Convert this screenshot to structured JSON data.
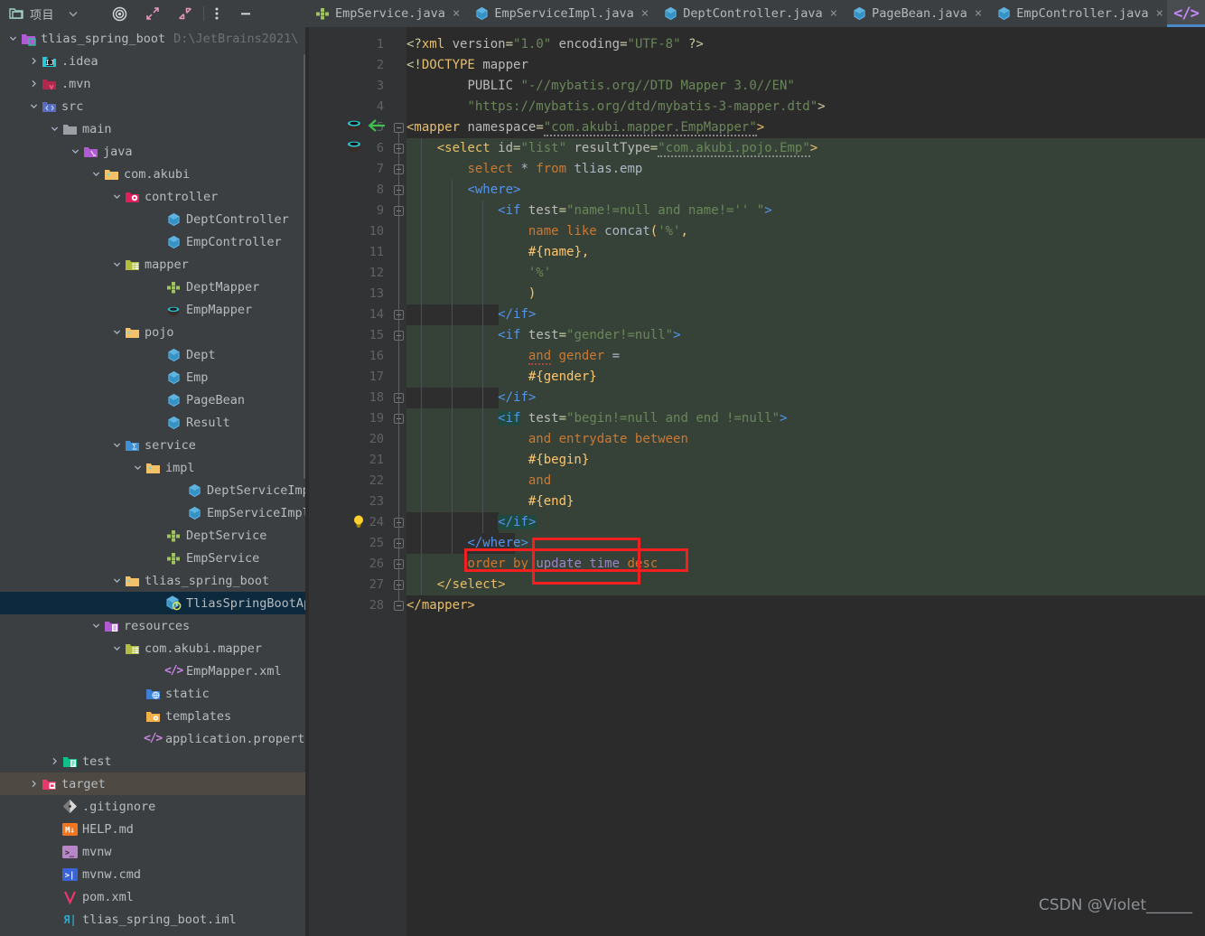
{
  "toolbar": {
    "project_label": "项目",
    "dropdown_icon": "chevron-down-icon",
    "locate_icon": "target-locate-icon",
    "expand_icon": "expand-all-icon",
    "collapse_icon": "collapse-all-icon",
    "options_icon": "more-options-icon",
    "minimize_icon": "minimize-icon"
  },
  "tabs": [
    {
      "label": "EmpService.java",
      "icon": "interface-icon",
      "close": "×"
    },
    {
      "label": "EmpServiceImpl.java",
      "icon": "class-icon",
      "close": "×"
    },
    {
      "label": "DeptController.java",
      "icon": "class-icon",
      "close": "×"
    },
    {
      "label": "PageBean.java",
      "icon": "class-icon",
      "close": "×"
    },
    {
      "label": "EmpController.java",
      "icon": "class-icon",
      "close": "×"
    }
  ],
  "code_toggle": {
    "glyph": "</>",
    "name": "code-view-toggle"
  },
  "sidebar": {
    "rows": [
      {
        "label": "tlias_spring_boot",
        "path": "D:\\JetBrains2021\\",
        "indent": 0,
        "arrow": "down",
        "icon": "module-folder-icon",
        "state": "normal"
      },
      {
        "label": ".idea",
        "path": "",
        "indent": 1,
        "arrow": "right",
        "icon": "idea-folder-icon",
        "state": "normal"
      },
      {
        "label": ".mvn",
        "path": "",
        "indent": 1,
        "arrow": "right",
        "icon": "maven-folder-icon",
        "state": "normal"
      },
      {
        "label": "src",
        "path": "",
        "indent": 1,
        "arrow": "down",
        "icon": "source-root-icon",
        "state": "normal"
      },
      {
        "label": "main",
        "path": "",
        "indent": 2,
        "arrow": "down",
        "icon": "plain-folder-icon",
        "state": "normal"
      },
      {
        "label": "java",
        "path": "",
        "indent": 3,
        "arrow": "down",
        "icon": "java-source-icon",
        "state": "normal"
      },
      {
        "label": "com.akubi",
        "path": "",
        "indent": 4,
        "arrow": "down",
        "icon": "package-icon",
        "state": "normal"
      },
      {
        "label": "controller",
        "path": "",
        "indent": 5,
        "arrow": "down",
        "icon": "spring-folder-icon",
        "state": "normal"
      },
      {
        "label": "DeptController",
        "path": "",
        "indent": 7,
        "arrow": "none",
        "icon": "class-icon",
        "state": "normal"
      },
      {
        "label": "EmpController",
        "path": "",
        "indent": 7,
        "arrow": "none",
        "icon": "class-icon",
        "state": "normal"
      },
      {
        "label": "mapper",
        "path": "",
        "indent": 5,
        "arrow": "down",
        "icon": "mapper-folder-icon",
        "state": "normal"
      },
      {
        "label": "DeptMapper",
        "path": "",
        "indent": 7,
        "arrow": "none",
        "icon": "interface-icon",
        "state": "normal"
      },
      {
        "label": "EmpMapper",
        "path": "",
        "indent": 7,
        "arrow": "none",
        "icon": "mybatis-icon",
        "state": "normal"
      },
      {
        "label": "pojo",
        "path": "",
        "indent": 5,
        "arrow": "down",
        "icon": "package-icon",
        "state": "normal"
      },
      {
        "label": "Dept",
        "path": "",
        "indent": 7,
        "arrow": "none",
        "icon": "class-icon",
        "state": "normal"
      },
      {
        "label": "Emp",
        "path": "",
        "indent": 7,
        "arrow": "none",
        "icon": "class-icon",
        "state": "normal"
      },
      {
        "label": "PageBean",
        "path": "",
        "indent": 7,
        "arrow": "none",
        "icon": "class-icon",
        "state": "normal"
      },
      {
        "label": "Result",
        "path": "",
        "indent": 7,
        "arrow": "none",
        "icon": "class-icon",
        "state": "normal"
      },
      {
        "label": "service",
        "path": "",
        "indent": 5,
        "arrow": "down",
        "icon": "service-folder-icon",
        "state": "normal"
      },
      {
        "label": "impl",
        "path": "",
        "indent": 6,
        "arrow": "down",
        "icon": "package-icon",
        "state": "normal"
      },
      {
        "label": "DeptServiceImpl",
        "path": "",
        "indent": 8,
        "arrow": "none",
        "icon": "class-icon",
        "state": "normal"
      },
      {
        "label": "EmpServiceImpl",
        "path": "",
        "indent": 8,
        "arrow": "none",
        "icon": "class-icon",
        "state": "normal"
      },
      {
        "label": "DeptService",
        "path": "",
        "indent": 7,
        "arrow": "none",
        "icon": "interface-icon",
        "state": "normal"
      },
      {
        "label": "EmpService",
        "path": "",
        "indent": 7,
        "arrow": "none",
        "icon": "interface-icon",
        "state": "normal"
      },
      {
        "label": "tlias_spring_boot",
        "path": "",
        "indent": 5,
        "arrow": "down",
        "icon": "package-icon",
        "state": "normal"
      },
      {
        "label": "TliasSpringBootApplic",
        "path": "",
        "indent": 7,
        "arrow": "none",
        "icon": "spring-boot-app-icon",
        "state": "selected"
      },
      {
        "label": "resources",
        "path": "",
        "indent": 4,
        "arrow": "down",
        "icon": "resource-root-icon",
        "state": "normal"
      },
      {
        "label": "com.akubi.mapper",
        "path": "",
        "indent": 5,
        "arrow": "down",
        "icon": "mapper-folder-icon",
        "state": "normal"
      },
      {
        "label": "EmpMapper.xml",
        "path": "",
        "indent": 7,
        "arrow": "none",
        "icon": "xml-file-icon",
        "state": "normal"
      },
      {
        "label": "static",
        "path": "",
        "indent": 6,
        "arrow": "none",
        "icon": "static-folder-icon",
        "state": "normal"
      },
      {
        "label": "templates",
        "path": "",
        "indent": 6,
        "arrow": "none",
        "icon": "templates-folder-icon",
        "state": "normal"
      },
      {
        "label": "application.properties",
        "path": "",
        "indent": 6,
        "arrow": "none",
        "icon": "properties-file-icon",
        "state": "normal"
      },
      {
        "label": "test",
        "path": "",
        "indent": 2,
        "arrow": "right",
        "icon": "test-root-icon",
        "state": "normal"
      },
      {
        "label": "target",
        "path": "",
        "indent": 1,
        "arrow": "right",
        "icon": "target-folder-icon",
        "state": "hover"
      },
      {
        "label": ".gitignore",
        "path": "",
        "indent": 2,
        "arrow": "none",
        "icon": "git-file-icon",
        "state": "normal"
      },
      {
        "label": "HELP.md",
        "path": "",
        "indent": 2,
        "arrow": "none",
        "icon": "markdown-file-icon",
        "state": "normal"
      },
      {
        "label": "mvnw",
        "path": "",
        "indent": 2,
        "arrow": "none",
        "icon": "shell-file-icon",
        "state": "normal"
      },
      {
        "label": "mvnw.cmd",
        "path": "",
        "indent": 2,
        "arrow": "none",
        "icon": "cmd-file-icon",
        "state": "normal"
      },
      {
        "label": "pom.xml",
        "path": "",
        "indent": 2,
        "arrow": "none",
        "icon": "maven-pom-icon",
        "state": "normal"
      },
      {
        "label": "tlias_spring_boot.iml",
        "path": "",
        "indent": 2,
        "arrow": "none",
        "icon": "iml-file-icon",
        "state": "normal"
      }
    ]
  },
  "editor": {
    "file": "EmpMapper.xml",
    "line_numbers": [
      1,
      2,
      3,
      4,
      5,
      6,
      7,
      8,
      9,
      10,
      11,
      12,
      13,
      14,
      15,
      16,
      17,
      18,
      19,
      20,
      21,
      22,
      23,
      24,
      25,
      26,
      27,
      28
    ],
    "lines": [
      {
        "n": 1,
        "text": "<?xml version=\"1.0\" encoding=\"UTF-8\" ?>"
      },
      {
        "n": 2,
        "text": "<!DOCTYPE mapper"
      },
      {
        "n": 3,
        "text": "        PUBLIC \"-//mybatis.org//DTD Mapper 3.0//EN\""
      },
      {
        "n": 4,
        "text": "        \"https://mybatis.org/dtd/mybatis-3-mapper.dtd\">"
      },
      {
        "n": 5,
        "text": "<mapper namespace=\"com.akubi.mapper.EmpMapper\">"
      },
      {
        "n": 6,
        "text": "    <select id=\"list\" resultType=\"com.akubi.pojo.Emp\">"
      },
      {
        "n": 7,
        "text": "        select * from tlias.emp"
      },
      {
        "n": 8,
        "text": "        <where>"
      },
      {
        "n": 9,
        "text": "            <if test=\"name!=null and name!='' \">"
      },
      {
        "n": 10,
        "text": "                name like concat('%',"
      },
      {
        "n": 11,
        "text": "                #{name},"
      },
      {
        "n": 12,
        "text": "                '%'"
      },
      {
        "n": 13,
        "text": "                )"
      },
      {
        "n": 14,
        "text": "            </if>"
      },
      {
        "n": 15,
        "text": "            <if test=\"gender!=null\">"
      },
      {
        "n": 16,
        "text": "                and gender ="
      },
      {
        "n": 17,
        "text": "                #{gender}"
      },
      {
        "n": 18,
        "text": "            </if>"
      },
      {
        "n": 19,
        "text": "            <if test=\"begin!=null and end !=null\">"
      },
      {
        "n": 20,
        "text": "                and entrydate between"
      },
      {
        "n": 21,
        "text": "                #{begin}"
      },
      {
        "n": 22,
        "text": "                and"
      },
      {
        "n": 23,
        "text": "                #{end}"
      },
      {
        "n": 24,
        "text": "            </if>"
      },
      {
        "n": 25,
        "text": "        </where>"
      },
      {
        "n": 26,
        "text": "        order by update_time desc"
      },
      {
        "n": 27,
        "text": "    </select>"
      },
      {
        "n": 28,
        "text": "</mapper>"
      }
    ],
    "gutter_icons": [
      {
        "line": 5,
        "icon": "mybatis-statement-icon"
      },
      {
        "line": 5,
        "icon": "navigate-left-arrow-icon"
      },
      {
        "line": 6,
        "icon": "mybatis-statement-icon"
      },
      {
        "line": 24,
        "icon": "intention-bulb-icon"
      }
    ],
    "annotations": [
      {
        "name": "order-by-highlight-box",
        "color": "#f41f1f"
      },
      {
        "name": "update-time-highlight-box",
        "color": "#f41f1f"
      }
    ]
  },
  "watermark": {
    "text": "CSDN @Violet______"
  },
  "colors": {
    "bg_editor": "#2b2b2b",
    "bg_panel": "#3c3f41",
    "bg_gutter": "#313335",
    "selection": "#0d293e",
    "hover": "#4e4a43",
    "block_green": "#364237",
    "accent_blue": "#4a88c7",
    "annotation_red": "#f41f1f"
  }
}
